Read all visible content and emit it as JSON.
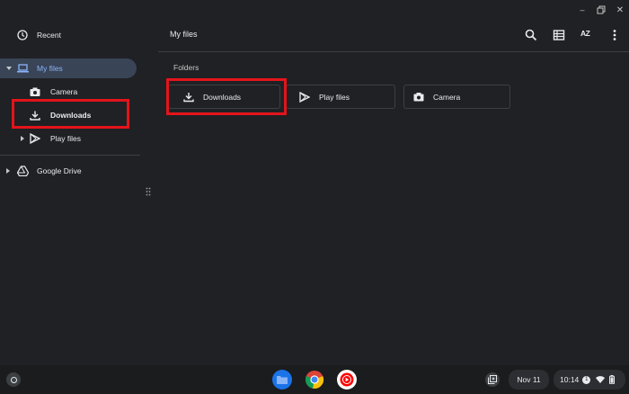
{
  "window": {
    "minimize": "–",
    "close": "✕"
  },
  "sidebar": {
    "recent": "Recent",
    "my_files": "My files",
    "camera": "Camera",
    "downloads": "Downloads",
    "play_files": "Play files",
    "google_drive": "Google Drive"
  },
  "header": {
    "title": "My files",
    "sort_icon_text": "AZ"
  },
  "main": {
    "section_label": "Folders",
    "folders": [
      {
        "label": "Downloads",
        "icon": "download-icon"
      },
      {
        "label": "Play files",
        "icon": "play-store-icon"
      },
      {
        "label": "Camera",
        "icon": "camera-icon"
      }
    ]
  },
  "shelf": {
    "date": "Nov 11",
    "time": "10:14",
    "notification_count": "1"
  },
  "colors": {
    "highlight": "#e3141b",
    "accent": "#8ab4f8",
    "selected_bg": "#394457"
  }
}
